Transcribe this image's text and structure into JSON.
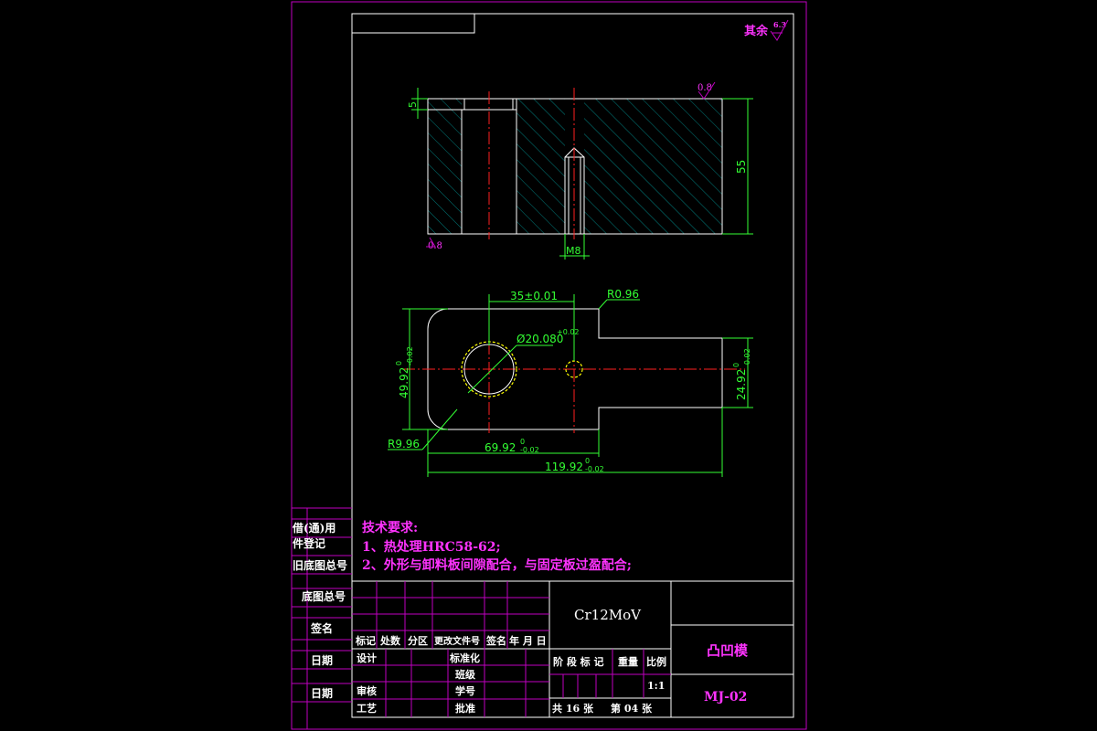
{
  "surface_note": {
    "label": "其余",
    "value": "6.3"
  },
  "front_view": {
    "roughness_top": "0.8",
    "roughness_bottom": "0.8",
    "dim_step": "5",
    "dim_height": "55",
    "dim_thread": "M8"
  },
  "top_view": {
    "dim_center_distance": "35±0.01",
    "dim_corner_radius": "R0.96",
    "dim_hole": "Ø20.080",
    "dim_hole_tol": "+0.02",
    "dim_height_left": "49.92",
    "dim_height_left_tol_up": "0",
    "dim_height_left_tol_dn": "-0.02",
    "dim_height_right": "24.92",
    "dim_height_right_tol_up": "0",
    "dim_height_right_tol_dn": "-0.02",
    "dim_radius_left": "R9.96",
    "dim_width_mid": "69.92",
    "dim_width_mid_tol_up": "0",
    "dim_width_mid_tol_dn": "-0.02",
    "dim_width_total": "119.92",
    "dim_width_total_tol_up": "0",
    "dim_width_total_tol_dn": "-0.02"
  },
  "tech_requirements": {
    "title": "技术要求:",
    "items": [
      "1、热处理HRC58-62;",
      "2、外形与卸料板间隙配合，与固定板过盈配合;"
    ]
  },
  "side_labels": [
    "借(通)用",
    "件登记",
    "旧底图总号",
    "底图总号",
    "签名",
    "日期",
    "日期"
  ],
  "title_block": {
    "material": "Cr12MoV",
    "part_name": "凸凹模",
    "drawing_no": "MJ-02",
    "rev_headers": [
      "标记",
      "处数",
      "分区",
      "更改文件号",
      "签名",
      "年 月 日"
    ],
    "roles_left": [
      "设计",
      "审核",
      "工艺"
    ],
    "roles_mid": [
      "标准化",
      "班级",
      "学号",
      "批准"
    ],
    "stage_headers": [
      "阶 段 标 记",
      "重量",
      "比例"
    ],
    "scale": "1:1",
    "sheets_total": "共 16 张",
    "sheet_no": "第 04 张"
  }
}
